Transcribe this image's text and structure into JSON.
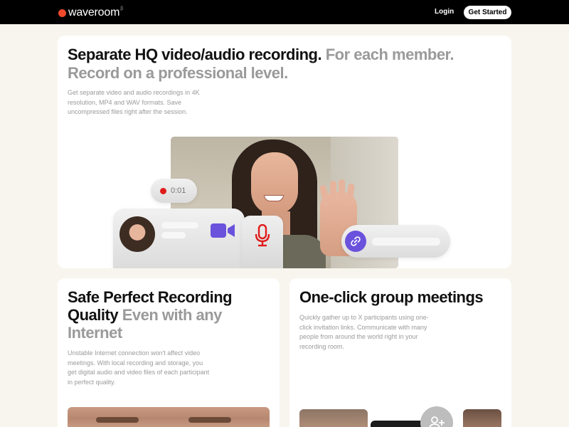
{
  "nav": {
    "logo_text": "waveroom",
    "logo_badge": "β",
    "login_label": "Login",
    "cta_label": "Get Started"
  },
  "hero": {
    "title_strong": "Separate HQ video/audio recording.",
    "title_muted": "For each member. Record on a professional level.",
    "description": "Get separate video and audio recordings in 4K resolution, MP4 and WAV formats. Save uncompressed files right after the session.",
    "timer": "0:01"
  },
  "card_quality": {
    "title_strong": "Safe Perfect Recording Quality",
    "title_muted": "Even with any Internet",
    "description": "Unstable Internet connection won't affect video meetings. With local recording and storage, you get digital audio and video files of each participant in perfect quality."
  },
  "card_group": {
    "title_strong": "One-click group meetings",
    "description": "Quickly gather up to X participants using one-click invitation links. Communicate with many people from around the world right in your recording room."
  },
  "colors": {
    "accent_red": "#e01b1b",
    "brand_orange": "#f24a2c",
    "accent_purple": "#6a52dc",
    "background": "#f8f5ee"
  },
  "icons": [
    "logo-dot-icon",
    "record-dot-icon",
    "video-camera-icon",
    "microphone-icon",
    "link-icon",
    "add-user-icon"
  ]
}
